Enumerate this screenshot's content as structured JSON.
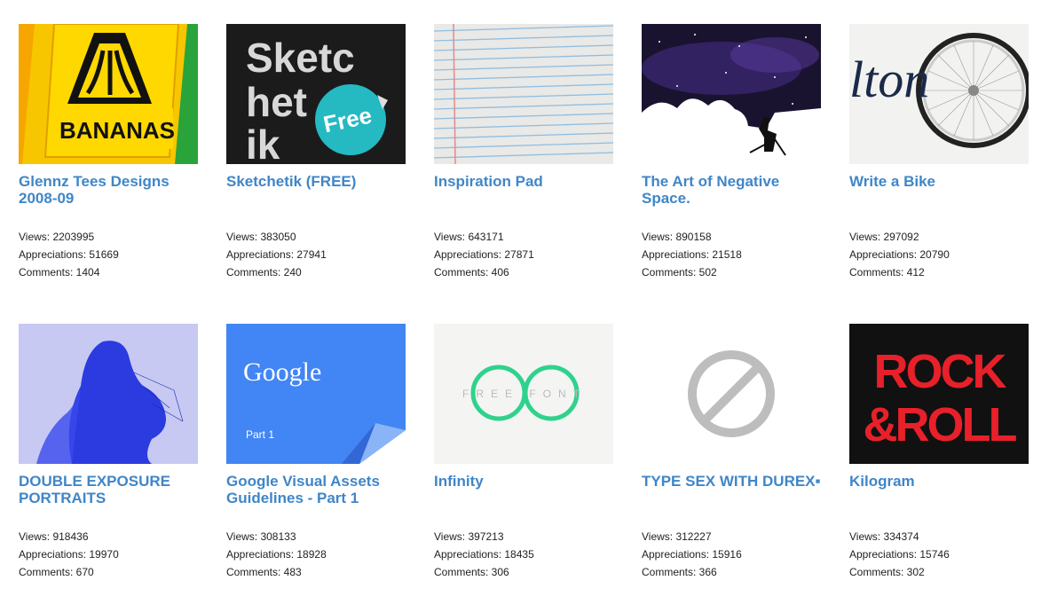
{
  "projects": [
    {
      "title": "Glennz Tees Designs 2008-09",
      "thumb_text": "BANANAS",
      "views": "Views: 2203995",
      "appreciations": "Appreciations: 51669",
      "comments": "Comments: 1404"
    },
    {
      "title": "Sketchetik (FREE)",
      "thumb_text": "Sketc het ik",
      "thumb_badge": "Free",
      "views": "Views: 383050",
      "appreciations": "Appreciations: 27941",
      "comments": "Comments: 240"
    },
    {
      "title": "Inspiration Pad",
      "views": "Views: 643171",
      "appreciations": "Appreciations: 27871",
      "comments": "Comments: 406"
    },
    {
      "title": "The Art of Negative Space.",
      "views": "Views: 890158",
      "appreciations": "Appreciations: 21518",
      "comments": "Comments: 502"
    },
    {
      "title": "Write a Bike",
      "thumb_text": "lton",
      "views": "Views: 297092",
      "appreciations": "Appreciations: 20790",
      "comments": "Comments: 412"
    },
    {
      "title": "DOUBLE EXPOSURE PORTRAITS",
      "views": "Views: 918436",
      "appreciations": "Appreciations: 19970",
      "comments": "Comments: 670"
    },
    {
      "title": "Google Visual Assets Guidelines - Part 1",
      "thumb_text": "Google",
      "thumb_sub": "Part 1",
      "views": "Views: 308133",
      "appreciations": "Appreciations: 18928",
      "comments": "Comments: 483"
    },
    {
      "title": "Infinity",
      "thumb_text": "FREE FONT",
      "views": "Views: 397213",
      "appreciations": "Appreciations: 18435",
      "comments": "Comments: 306"
    },
    {
      "title": "TYPE SEX WITH DUREX▪",
      "views": "Views: 312227",
      "appreciations": "Appreciations: 15916",
      "comments": "Comments: 366"
    },
    {
      "title": "Kilogram",
      "thumb_text": "ROCK &ROLL",
      "views": "Views: 334374",
      "appreciations": "Appreciations: 15746",
      "comments": "Comments: 302"
    }
  ],
  "colors": {
    "title": "#3f86c8",
    "text": "#222222"
  }
}
